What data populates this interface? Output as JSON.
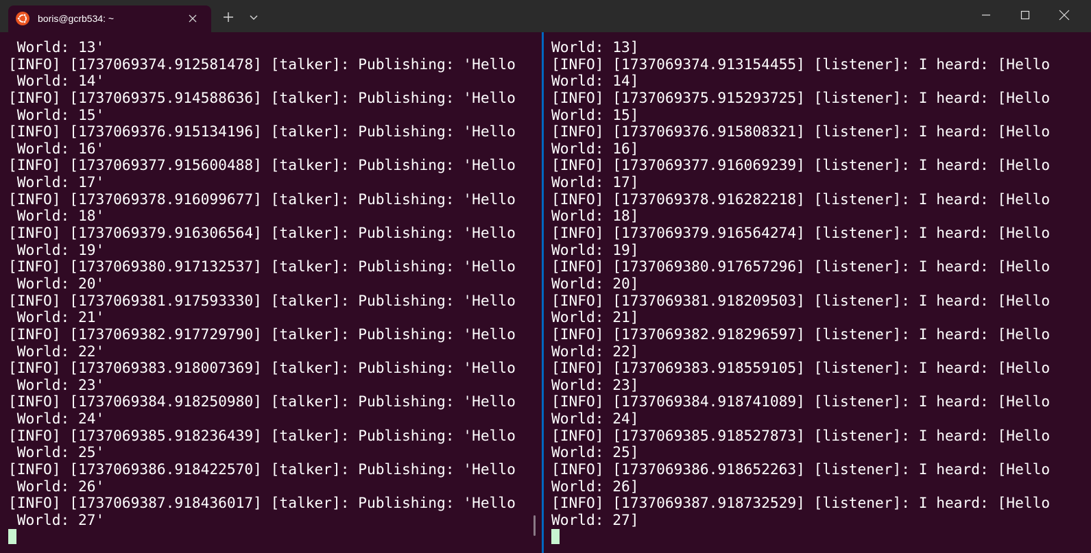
{
  "tab": {
    "title": "boris@gcrb534: ~"
  },
  "titlebar": {
    "new_tab_icon": "plus-icon",
    "dropdown_icon": "chevron-down-icon",
    "minimize_icon": "minimize-icon",
    "maximize_icon": "maximize-icon",
    "close_icon": "close-icon"
  },
  "colors": {
    "terminal_background": "#300a24",
    "titlebar_background": "#2b2b2b",
    "pane_divider": "#0067c0",
    "ubuntu_orange": "#e95420",
    "cursor": "#c8f5d0",
    "text": "#ffffff"
  },
  "left_pane": {
    "lines": [
      " World: 13'",
      "[INFO] [1737069374.912581478] [talker]: Publishing: 'Hello",
      " World: 14'",
      "[INFO] [1737069375.914588636] [talker]: Publishing: 'Hello",
      " World: 15'",
      "[INFO] [1737069376.915134196] [talker]: Publishing: 'Hello",
      " World: 16'",
      "[INFO] [1737069377.915600488] [talker]: Publishing: 'Hello",
      " World: 17'",
      "[INFO] [1737069378.916099677] [talker]: Publishing: 'Hello",
      " World: 18'",
      "[INFO] [1737069379.916306564] [talker]: Publishing: 'Hello",
      " World: 19'",
      "[INFO] [1737069380.917132537] [talker]: Publishing: 'Hello",
      " World: 20'",
      "[INFO] [1737069381.917593330] [talker]: Publishing: 'Hello",
      " World: 21'",
      "[INFO] [1737069382.917729790] [talker]: Publishing: 'Hello",
      " World: 22'",
      "[INFO] [1737069383.918007369] [talker]: Publishing: 'Hello",
      " World: 23'",
      "[INFO] [1737069384.918250980] [talker]: Publishing: 'Hello",
      " World: 24'",
      "[INFO] [1737069385.918236439] [talker]: Publishing: 'Hello",
      " World: 25'",
      "[INFO] [1737069386.918422570] [talker]: Publishing: 'Hello",
      " World: 26'",
      "[INFO] [1737069387.918436017] [talker]: Publishing: 'Hello",
      " World: 27'"
    ]
  },
  "right_pane": {
    "lines": [
      "World: 13]",
      "[INFO] [1737069374.913154455] [listener]: I heard: [Hello",
      "World: 14]",
      "[INFO] [1737069375.915293725] [listener]: I heard: [Hello",
      "World: 15]",
      "[INFO] [1737069376.915808321] [listener]: I heard: [Hello",
      "World: 16]",
      "[INFO] [1737069377.916069239] [listener]: I heard: [Hello",
      "World: 17]",
      "[INFO] [1737069378.916282218] [listener]: I heard: [Hello",
      "World: 18]",
      "[INFO] [1737069379.916564274] [listener]: I heard: [Hello",
      "World: 19]",
      "[INFO] [1737069380.917657296] [listener]: I heard: [Hello",
      "World: 20]",
      "[INFO] [1737069381.918209503] [listener]: I heard: [Hello",
      "World: 21]",
      "[INFO] [1737069382.918296597] [listener]: I heard: [Hello",
      "World: 22]",
      "[INFO] [1737069383.918559105] [listener]: I heard: [Hello",
      "World: 23]",
      "[INFO] [1737069384.918741089] [listener]: I heard: [Hello",
      "World: 24]",
      "[INFO] [1737069385.918527873] [listener]: I heard: [Hello",
      "World: 25]",
      "[INFO] [1737069386.918652263] [listener]: I heard: [Hello",
      "World: 26]",
      "[INFO] [1737069387.918732529] [listener]: I heard: [Hello",
      "World: 27]"
    ]
  }
}
